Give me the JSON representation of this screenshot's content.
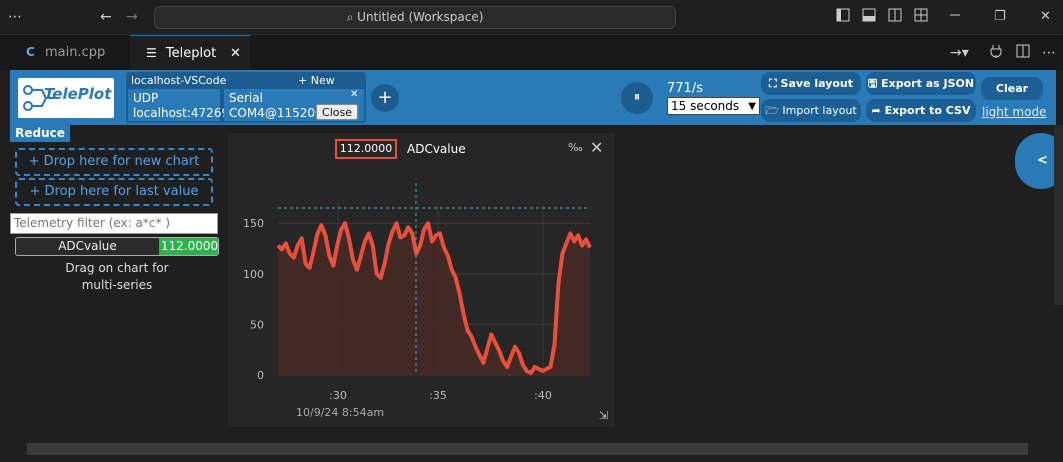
{
  "titlebar": {
    "menu_glyph": "⋯",
    "back_glyph": "←",
    "forward_glyph": "→",
    "search_icon": "⌕",
    "search_text": "Untitled (Workspace)",
    "restore_glyph": "❐",
    "close_glyph": "✕"
  },
  "tabs": [
    {
      "label": "main.cpp",
      "icon": "c-lang-icon"
    },
    {
      "label": "Teleplot",
      "icon": "teleplot-icon",
      "close": "✕"
    }
  ],
  "teleplot": {
    "logo_text": "TelePlot",
    "connection": {
      "host_label": "localhost-VSCode",
      "new_serial_label": "+ New Serial",
      "udp_label": "UDP",
      "udp_address": "localhost:47269",
      "serial_label": "Serial",
      "serial_port": "COM4@115200",
      "close_label": "Close",
      "x_glyph": "✕"
    },
    "add_glyph": "+",
    "pause_glyph": "⏸",
    "rate": "771/s",
    "window_select": "15 seconds",
    "buttons": {
      "save_layout": "Save layout",
      "import_layout": "Import layout",
      "export_json": "Export as JSON",
      "export_csv": "Export to CSV",
      "clear": "Clear",
      "light_mode": "light mode"
    }
  },
  "sidebar": {
    "reduce": "Reduce",
    "drop_new": "+ Drop here for new chart",
    "drop_last": "+ Drop here for last value",
    "filter_placeholder": "Telemetry filter (ex: a*c* )",
    "variable_name": "ADCvalue",
    "variable_value": "112.0000",
    "hint_line1": "Drag on chart for",
    "hint_line2": "multi-series"
  },
  "chart_panel": {
    "current_value": "112.0000",
    "series_label": "ADCvalue",
    "permille_glyph": "‰",
    "close_glyph": "✕",
    "date_label": "10/9/24 8:54am",
    "colors": {
      "line": "#e8503c",
      "fill": "#4a2a26",
      "grid": "#3a3a3a",
      "cursor": "#5aa0b0"
    }
  },
  "right_toggle": "<",
  "chart_data": {
    "type": "line",
    "series": [
      {
        "name": "ADCvalue",
        "values": [
          128,
          124,
          130,
          120,
          116,
          128,
          135,
          110,
          106,
          122,
          140,
          148,
          138,
          118,
          108,
          128,
          144,
          150,
          134,
          114,
          104,
          118,
          132,
          140,
          128,
          100,
          96,
          110,
          130,
          142,
          150,
          136,
          138,
          146,
          140,
          120,
          128,
          144,
          150,
          132,
          138,
          140,
          126,
          118,
          104,
          96,
          80,
          60,
          44,
          38,
          28,
          20,
          12,
          26,
          40,
          32,
          24,
          14,
          8,
          18,
          28,
          22,
          10,
          4,
          2,
          8,
          6,
          4,
          6,
          8,
          30,
          90,
          120,
          130,
          140,
          132,
          138,
          128,
          134,
          126
        ]
      }
    ],
    "x_ticks": [
      ":30",
      ":35",
      ":40"
    ],
    "y_ticks": [
      "0",
      "50",
      "100",
      "150"
    ],
    "ylim": [
      0,
      170
    ],
    "grid": true
  }
}
